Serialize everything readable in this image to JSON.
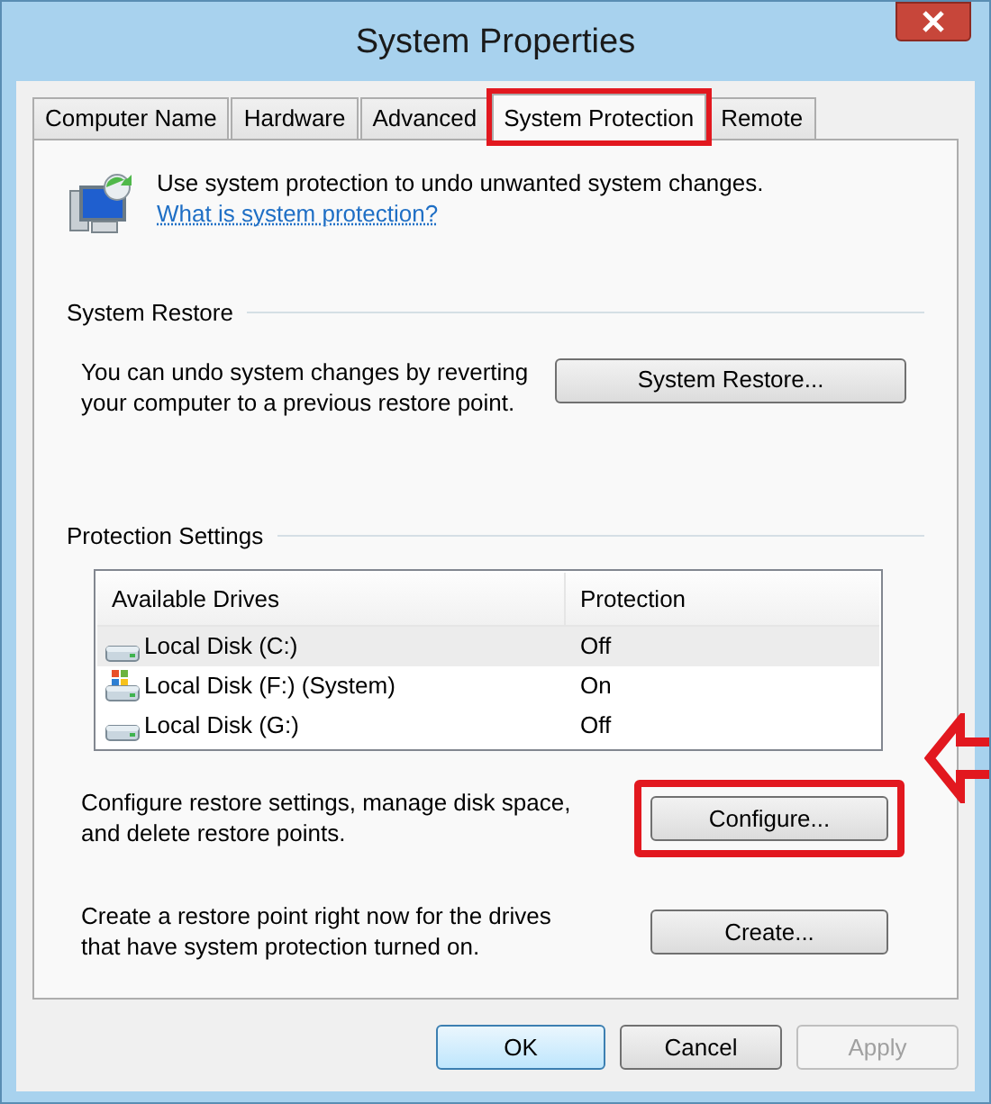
{
  "window": {
    "title": "System Properties"
  },
  "tabs": [
    {
      "label": "Computer Name",
      "selected": false,
      "highlighted": false
    },
    {
      "label": "Hardware",
      "selected": false,
      "highlighted": false
    },
    {
      "label": "Advanced",
      "selected": false,
      "highlighted": false
    },
    {
      "label": "System Protection",
      "selected": true,
      "highlighted": true
    },
    {
      "label": "Remote",
      "selected": false,
      "highlighted": false
    }
  ],
  "intro": {
    "text": "Use system protection to undo unwanted system changes.",
    "link": "What is system protection?"
  },
  "system_restore": {
    "heading": "System Restore",
    "text": "You can undo system changes by reverting your computer to a previous restore point.",
    "button": "System Restore..."
  },
  "protection_settings": {
    "heading": "Protection Settings",
    "table": {
      "columns": [
        "Available Drives",
        "Protection"
      ],
      "rows": [
        {
          "drive": "Local Disk (C:)",
          "protection": "Off",
          "kind": "disk",
          "selected": true
        },
        {
          "drive": "Local Disk (F:) (System)",
          "protection": "On",
          "kind": "system",
          "selected": false
        },
        {
          "drive": "Local Disk (G:)",
          "protection": "Off",
          "kind": "disk",
          "selected": false
        }
      ]
    },
    "actions": [
      {
        "text": "Configure restore settings, manage disk space, and delete restore points.",
        "button": "Configure...",
        "highlighted": true
      },
      {
        "text": "Create a restore point right now for the drives that have system protection turned on.",
        "button": "Create...",
        "highlighted": false
      }
    ]
  },
  "buttons": [
    {
      "label": "OK",
      "default": true,
      "disabled": false
    },
    {
      "label": "Cancel",
      "default": false,
      "disabled": false
    },
    {
      "label": "Apply",
      "default": false,
      "disabled": true
    }
  ]
}
